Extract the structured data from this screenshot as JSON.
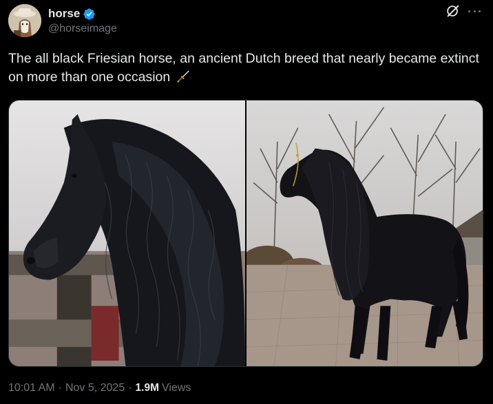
{
  "author": {
    "display_name": "horse",
    "handle": "@horseimage",
    "verified": true,
    "verified_color": "#1d9bf0"
  },
  "tweet": {
    "text": "The all black Friesian horse, an ancient Dutch breed that nearly became extinct on more than one occasion",
    "emoji_icon": "dagger-icon"
  },
  "media": [
    {
      "icon": "photo",
      "name": "horse-head-closeup"
    },
    {
      "icon": "photo",
      "name": "horse-standing-courtyard"
    }
  ],
  "meta": {
    "time": "10:01 AM",
    "date": "Nov 5, 2025",
    "views_count": "1.9M",
    "views_label": "Views"
  },
  "icons": {
    "grok": "grok-icon",
    "more": "more-icon"
  }
}
